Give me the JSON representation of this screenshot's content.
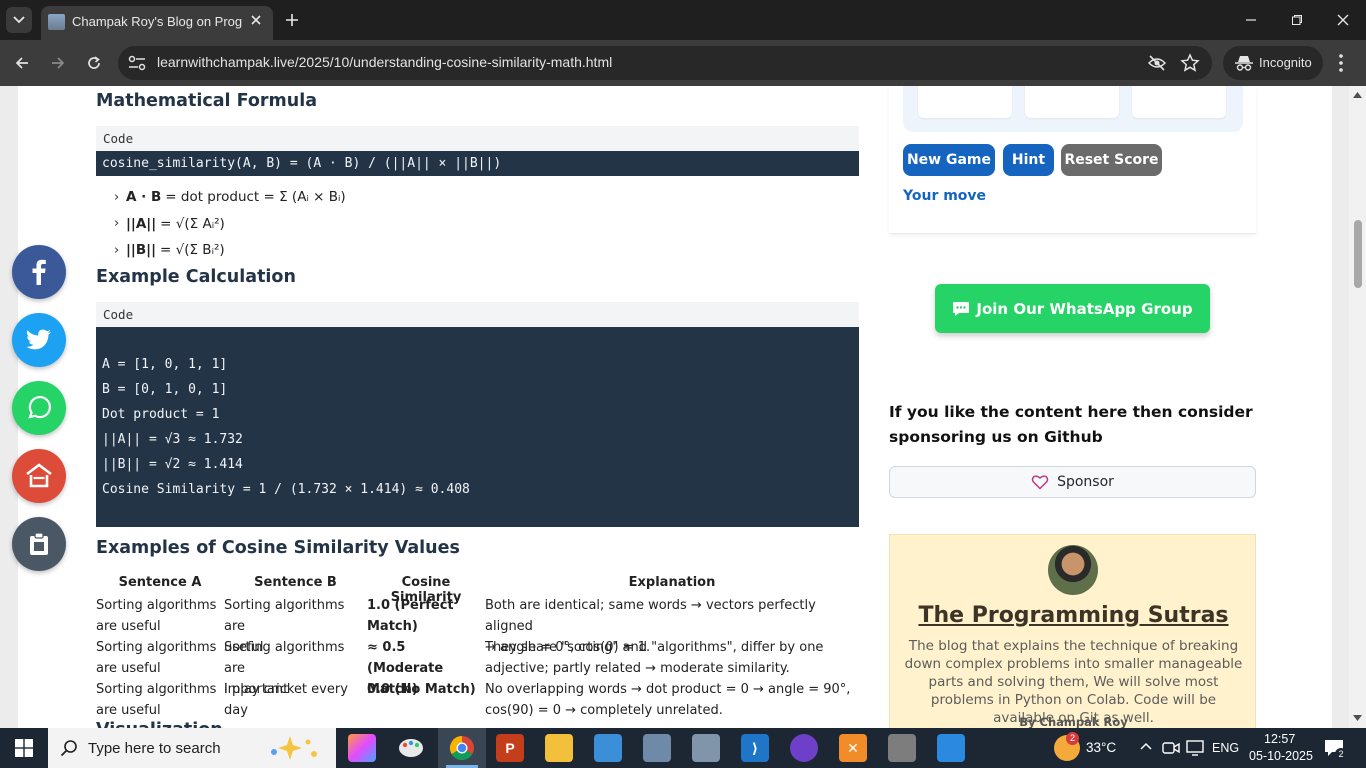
{
  "browser": {
    "tab_title": "Champak Roy's Blog on Progra",
    "url": "learnwithchampak.live/2025/10/understanding-cosine-similarity-math.html",
    "incognito_label": "Incognito"
  },
  "article": {
    "formula_heading": "Mathematical Formula",
    "formula_code_label": "Code",
    "formula_code": "cosine_similarity(A, B) = (A · B) / (||A|| × ||B||)",
    "formula_bullets": [
      {
        "term": "A · B",
        "desc": "= dot product = Σ (Aᵢ × Bᵢ)"
      },
      {
        "term": "||A||",
        "desc": "= √(Σ Aᵢ²)"
      },
      {
        "term": "||B||",
        "desc": "= √(Σ Bᵢ²)"
      }
    ],
    "example_heading": "Example Calculation",
    "example_code_label": "Code",
    "example_code_lines": [
      "A = [1, 0, 1, 1]",
      "B = [0, 1, 0, 1]",
      "Dot product = 1",
      "||A|| = √3 ≈ 1.732",
      "||B|| = √2 ≈ 1.414",
      "Cosine Similarity = 1 / (1.732 × 1.414) ≈ 0.408"
    ],
    "values_heading": "Examples of Cosine Similarity Values",
    "table_headers": [
      "Sentence A",
      "Sentence B",
      "Cosine Similarity",
      "Explanation"
    ],
    "table_rows": [
      {
        "a": [
          "Sorting algorithms",
          "are useful"
        ],
        "b": [
          "Sorting algorithms are",
          "useful"
        ],
        "sim": [
          "1.0 (Perfect",
          "Match)"
        ],
        "exp": [
          "Both are identical; same words → vectors perfectly aligned",
          "→ angle = 0°, cos(0) = 1."
        ]
      },
      {
        "a": [
          "Sorting algorithms",
          "are useful"
        ],
        "b": [
          "Sorting algorithms are",
          "important"
        ],
        "sim": [
          "≈ 0.5 (Moderate",
          "Match)"
        ],
        "exp": [
          "They share \"sorting\" and \"algorithms\", differ by one",
          "adjective; partly related → moderate similarity."
        ]
      },
      {
        "a": [
          "Sorting algorithms",
          "are useful"
        ],
        "b": [
          "I play cricket every day",
          ""
        ],
        "sim": [
          "0.0 (No Match)",
          ""
        ],
        "exp": [
          "No overlapping words → dot product = 0 → angle = 90°,",
          "cos(90) = 0 → completely unrelated."
        ]
      }
    ],
    "next_heading_partial": "Visualization"
  },
  "sidebar": {
    "game_buttons": {
      "new_game": "New Game",
      "hint": "Hint",
      "reset": "Reset Score"
    },
    "game_status": "Your move",
    "whatsapp_label": "Join Our WhatsApp Group",
    "sponsor_text": "If you like the content here then consider sponsoring us on Github",
    "sponsor_button": "Sponsor",
    "blog_title": "The Programming Sutras",
    "blog_description": "The blog that explains the technique of breaking down complex problems into smaller manageable parts and solving them, We will solve most problems in Python on Colab. Code will be available on Git as well.",
    "by_line": "By Champak Roy"
  },
  "taskbar": {
    "search_placeholder": "Type here to search",
    "weather": "33°C",
    "weather_badge": "2",
    "language": "ENG",
    "time": "12:57",
    "date": "05-10-2025",
    "notification_count": "2"
  },
  "colors": {
    "code_bg": "#243447",
    "game_blue": "#1565c0",
    "reset_gray": "#6b6b6b",
    "whatsapp_green": "#25d366",
    "facebook": "#3b5998",
    "twitter": "#1da1f2",
    "whatsapp": "#25d366",
    "home": "#dd4b39",
    "clipboard": "#4a5866"
  }
}
